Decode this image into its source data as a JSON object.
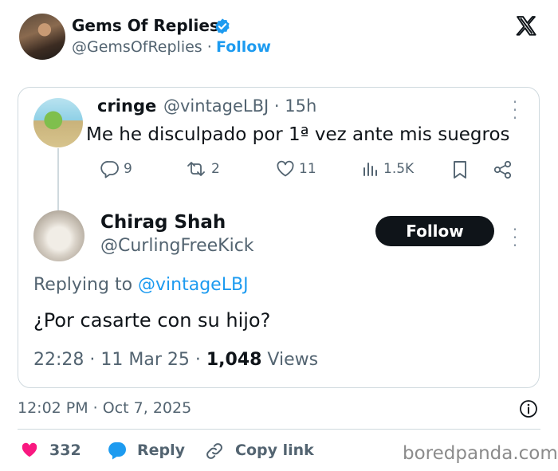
{
  "outer": {
    "name": "Gems Of Replies",
    "handle": "@GemsOfReplies",
    "separator": "·",
    "follow_label": "Follow",
    "timestamp": "12:02 PM · Oct 7, 2025",
    "like_count": "332",
    "reply_label": "Reply",
    "copy_link_label": "Copy link"
  },
  "quoted": {
    "name": "cringe",
    "handle": "@vintageLBJ",
    "time": "· 15h",
    "text": "Me he disculpado por 1ª vez ante mis suegros",
    "replies": "9",
    "reposts": "2",
    "likes": "11",
    "views": "1.5K"
  },
  "reply": {
    "name": "Chirag Shah",
    "handle": "@CurlingFreeKick",
    "follow_label": "Follow",
    "replying_prefix": "Replying to ",
    "replying_to": "@vintageLBJ",
    "text": "¿Por casarte con su hijo?",
    "datetime": "22:28 · 11 Mar 25 · ",
    "views_count": "1,048",
    "views_label": " Views"
  },
  "watermark": "boredpanda.com",
  "colors": {
    "accent": "#1d9bf0",
    "like": "#f91880",
    "text": "#0f1419",
    "muted": "#536471",
    "border": "#cfd9de"
  },
  "icons": {
    "verified": "verified-badge-icon",
    "x_logo": "x-logo-icon",
    "reply": "comment-bubble-icon",
    "repost": "repost-arrows-icon",
    "like": "heart-icon",
    "views": "bar-chart-icon",
    "bookmark": "bookmark-icon",
    "share": "share-icon",
    "info": "info-icon",
    "link": "link-icon"
  }
}
